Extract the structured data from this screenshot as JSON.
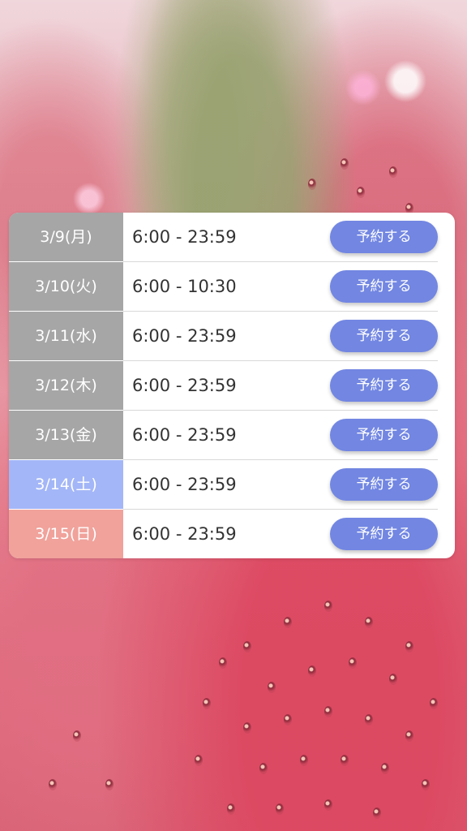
{
  "colors": {
    "weekday": "#a6a6a6",
    "saturday": "#a3b6f7",
    "sunday": "#f0a29b",
    "button": "#7286e2"
  },
  "schedule": [
    {
      "date": "3/9(月)",
      "time": "6:00 - 23:59",
      "button": "予約する",
      "day_type": "weekday"
    },
    {
      "date": "3/10(火)",
      "time": "6:00 - 10:30",
      "button": "予約する",
      "day_type": "weekday"
    },
    {
      "date": "3/11(水)",
      "time": "6:00 - 23:59",
      "button": "予約する",
      "day_type": "weekday"
    },
    {
      "date": "3/12(木)",
      "time": "6:00 - 23:59",
      "button": "予約する",
      "day_type": "weekday"
    },
    {
      "date": "3/13(金)",
      "time": "6:00 - 23:59",
      "button": "予約する",
      "day_type": "weekday"
    },
    {
      "date": "3/14(土)",
      "time": "6:00 - 23:59",
      "button": "予約する",
      "day_type": "saturday"
    },
    {
      "date": "3/15(日)",
      "time": "6:00 - 23:59",
      "button": "予約する",
      "day_type": "sunday"
    }
  ]
}
